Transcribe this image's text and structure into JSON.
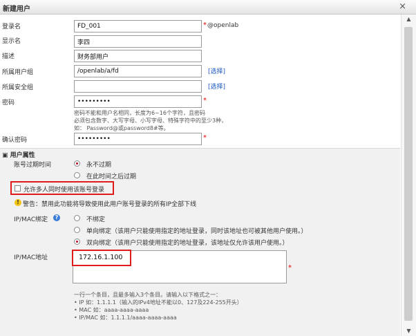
{
  "dialog": {
    "title": "新建用户",
    "close": "×"
  },
  "form": {
    "login_name": {
      "label": "登录名",
      "value": "FD_001",
      "suffix": "@openlab"
    },
    "display_name": {
      "label": "显示名",
      "value": "李四"
    },
    "description": {
      "label": "描述",
      "value": "财务部用户"
    },
    "user_group": {
      "label": "所属用户组",
      "value": "/openlab/a/fd",
      "select": "[选择]"
    },
    "security_group": {
      "label": "所属安全组",
      "value": "",
      "select": "[选择]"
    },
    "password": {
      "label": "密码",
      "value": "•••••••••"
    },
    "password_hint": [
      "密码不能和用户名相同，长度为6~16个字符，且密码",
      "必须包含数字、大写字母、小写字母、特殊字符中的至少3种，",
      "如： Password@或password8#等。"
    ],
    "confirm_password": {
      "label": "确认密码",
      "value": "•••••••••"
    },
    "required_mark": "*"
  },
  "attributes": {
    "title": "用户属性",
    "expiry_label": "账号过期时间",
    "expiry_options": [
      "永不过期",
      "在此时间之后过期"
    ],
    "multi_login_label": "允许多人同时使用该账号登录",
    "warning": "警告：禁用此功能将导致使用此用户账号登录的所有IP全部下线",
    "binding_label": "IP/MAC绑定",
    "binding_options": [
      "不绑定",
      "单向绑定（该用户只能使用指定的地址登录，同时该地址也可被其他用户使用。）",
      "双向绑定（该用户只能使用指定的地址登录，该地址仅允许该用户使用。）"
    ],
    "address_label": "IP/MAC地址",
    "address_value": "172.16.1.100",
    "address_hint": [
      "一行一个条目，且最多输入3个条目。请输入以下格式之一：",
      "•  IP 如：1.1.1.1（输入的IPv4地址不能以0、127及224-255开头）",
      "•  MAC 如：aaaa-aaaa-aaaa",
      "•  IP/MAC 如：1.1.1.1/aaaa-aaaa-aaaa"
    ]
  },
  "scrollbar": {
    "up": "▲",
    "down": "▼"
  }
}
